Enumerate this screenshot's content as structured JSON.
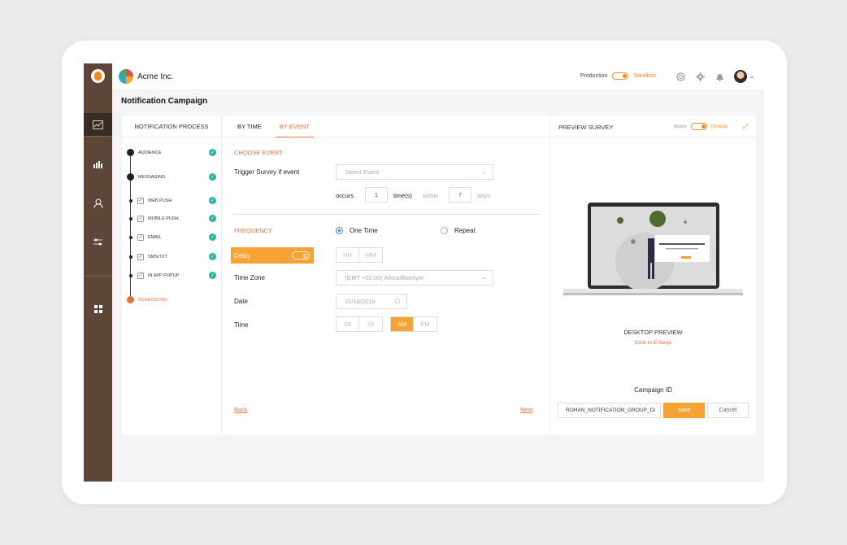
{
  "brand": {
    "name": "Acme Inc."
  },
  "env": {
    "production": "Production",
    "sandbox": "Sandbox"
  },
  "page": {
    "title": "Notification Campaign"
  },
  "process": {
    "header": "NOTIFICATION PROCESS",
    "steps": [
      {
        "label": "AUDIENCE"
      },
      {
        "label": "MESSAGING"
      },
      {
        "label": "WEB PUSH"
      },
      {
        "label": "MOBILE PUSH"
      },
      {
        "label": "EMAIL"
      },
      {
        "label": "SMS/TXT"
      },
      {
        "label": "IN APP POPUP"
      },
      {
        "label": "SCHEDULING"
      }
    ]
  },
  "tabs": {
    "by_time": "BY TIME",
    "by_event": "BY EVENT"
  },
  "event": {
    "section": "CHOOSE EVENT",
    "trigger_label": "Trigger Survey if event",
    "select_placeholder": "Select Event",
    "occurs": "occurs",
    "occurs_value": "1",
    "times_within": "time(s)",
    "within": "within",
    "days_value": "7",
    "days": "days"
  },
  "frequency": {
    "section": "FREQUENCY",
    "one_time": "One Time",
    "repeat": "Repeat",
    "delay": "Delay",
    "hh": "HH",
    "mm": "MM",
    "timezone_label": "Time Zone",
    "timezone_value": "(GMT +02:00) Africa/Blantyre",
    "date_label": "Date",
    "date_value": "10/18/2019",
    "time_label": "Time",
    "time_hour": "09",
    "time_min": "25",
    "am": "AM",
    "pm": "PM"
  },
  "nav": {
    "back": "Back",
    "next": "Next"
  },
  "preview": {
    "header": "PREVIEW SURVEY",
    "mobile": "Mobile",
    "desktop": "Desktop",
    "desktop_preview": "DESKTOP PREVIEW",
    "click_enlarge": "Click to Enlarge",
    "campaign_id_label": "Campaign ID",
    "campaign_id_value": "ROHAN_NOTIFICATION_GROUP_DI",
    "save": "Save",
    "cancel": "Cancel"
  },
  "colors": {
    "accent": "#f5703b",
    "orange": "#f7a235",
    "sidebar": "#5d4638",
    "teal": "#2bb3a4"
  }
}
